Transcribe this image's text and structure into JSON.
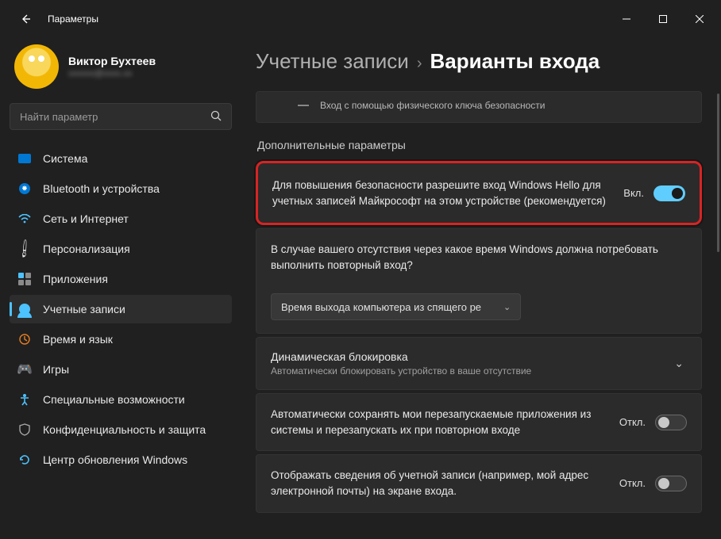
{
  "window": {
    "title": "Параметры"
  },
  "profile": {
    "name": "Виктор Бухтеев",
    "email_masked": "xxxxxx@xxxx.xx"
  },
  "search": {
    "placeholder": "Найти параметр"
  },
  "sidebar": {
    "items": [
      {
        "label": "Система"
      },
      {
        "label": "Bluetooth и устройства"
      },
      {
        "label": "Сеть и Интернет"
      },
      {
        "label": "Персонализация"
      },
      {
        "label": "Приложения"
      },
      {
        "label": "Учетные записи"
      },
      {
        "label": "Время и язык"
      },
      {
        "label": "Игры"
      },
      {
        "label": "Специальные возможности"
      },
      {
        "label": "Конфиденциальность и защита"
      },
      {
        "label": "Центр обновления Windows"
      }
    ],
    "active_index": 5
  },
  "breadcrumb": {
    "parent": "Учетные записи",
    "current": "Варианты входа"
  },
  "security_key_row": "Вход с помощью физического ключа безопасности",
  "section_label": "Дополнительные параметры",
  "settings": {
    "hello": {
      "text": "Для повышения безопасности разрешите вход Windows Hello для учетных записей Майкрософт на этом устройстве (рекомендуется)",
      "state_label": "Вкл.",
      "state": true
    },
    "reauth": {
      "text": "В случае вашего отсутствия через какое время Windows должна потребовать выполнить повторный вход?",
      "dropdown_value": "Время выхода компьютера из спящего ре"
    },
    "dynamic_lock": {
      "title": "Динамическая блокировка",
      "desc": "Автоматически блокировать устройство в ваше отсутствие"
    },
    "autosave_apps": {
      "text": "Автоматически сохранять мои перезапускаемые приложения из системы и перезапускать их при повторном входе",
      "state_label": "Откл.",
      "state": false
    },
    "show_account": {
      "text": "Отображать сведения об учетной записи (например, мой адрес электронной почты) на экране входа.",
      "state_label": "Откл.",
      "state": false
    }
  }
}
